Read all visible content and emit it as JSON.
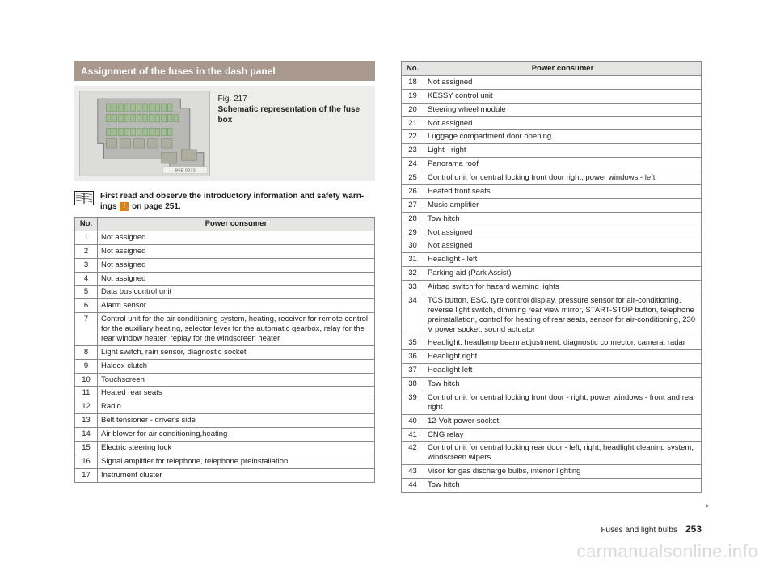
{
  "section_title": "Assignment of the fuses in the dash panel",
  "figure": {
    "num": "Fig. 217",
    "title": "Schematic representation of the fuse box",
    "code": "B5E-0233"
  },
  "note": {
    "text_a": "First read and observe the introductory information and safety warn-",
    "text_b": "ings ",
    "text_c": " on page 251.",
    "warn_glyph": "!"
  },
  "headers": {
    "no": "No.",
    "pc": "Power consumer"
  },
  "fuses_left": [
    {
      "no": "1",
      "pc": "Not assigned"
    },
    {
      "no": "2",
      "pc": "Not assigned"
    },
    {
      "no": "3",
      "pc": "Not assigned"
    },
    {
      "no": "4",
      "pc": "Not assigned"
    },
    {
      "no": "5",
      "pc": "Data bus control unit"
    },
    {
      "no": "6",
      "pc": "Alarm sensor"
    },
    {
      "no": "7",
      "pc": "Control unit for the air conditioning system, heating, receiver for remote control for the auxiliary heating, selector lever for the automatic gearbox, relay for the rear window heater, replay for the windscreen heater"
    },
    {
      "no": "8",
      "pc": "Light switch, rain sensor, diagnostic socket"
    },
    {
      "no": "9",
      "pc": "Haldex clutch"
    },
    {
      "no": "10",
      "pc": "Touchscreen"
    },
    {
      "no": "11",
      "pc": "Heated rear seats"
    },
    {
      "no": "12",
      "pc": "Radio"
    },
    {
      "no": "13",
      "pc": "Belt tensioner - driver's side"
    },
    {
      "no": "14",
      "pc": "Air blower for air conditioning,heating"
    },
    {
      "no": "15",
      "pc": "Electric steering lock"
    },
    {
      "no": "16",
      "pc": "Signal amplifier for telephone, telephone preinstallation"
    },
    {
      "no": "17",
      "pc": "Instrument cluster"
    }
  ],
  "fuses_right": [
    {
      "no": "18",
      "pc": "Not assigned"
    },
    {
      "no": "19",
      "pc": "KESSY control unit"
    },
    {
      "no": "20",
      "pc": "Steering wheel module"
    },
    {
      "no": "21",
      "pc": "Not assigned"
    },
    {
      "no": "22",
      "pc": "Luggage compartment door opening"
    },
    {
      "no": "23",
      "pc": "Light - right"
    },
    {
      "no": "24",
      "pc": "Panorama roof"
    },
    {
      "no": "25",
      "pc": "Control unit for central locking front door right, power windows - left"
    },
    {
      "no": "26",
      "pc": "Heated front seats"
    },
    {
      "no": "27",
      "pc": "Music amplifier"
    },
    {
      "no": "28",
      "pc": "Tow hitch"
    },
    {
      "no": "29",
      "pc": "Not assigned"
    },
    {
      "no": "30",
      "pc": "Not assigned"
    },
    {
      "no": "31",
      "pc": "Headlight - left"
    },
    {
      "no": "32",
      "pc": "Parking aid (Park Assist)"
    },
    {
      "no": "33",
      "pc": "Airbag switch for hazard warning lights"
    },
    {
      "no": "34",
      "pc": "TCS button, ESC, tyre control display, pressure sensor for air-conditioning, reverse light switch, dimming rear view mirror, START-STOP button, telephone preinstallation, control for heating of rear seats, sensor for air-conditioning, 230 V power socket, sound actuator"
    },
    {
      "no": "35",
      "pc": "Headlight, headlamp beam adjustment, diagnostic connector, camera, radar"
    },
    {
      "no": "36",
      "pc": "Headlight right"
    },
    {
      "no": "37",
      "pc": "Headlight left"
    },
    {
      "no": "38",
      "pc": "Tow hitch"
    },
    {
      "no": "39",
      "pc": "Control unit for central locking front door - right, power windows - front and rear right"
    },
    {
      "no": "40",
      "pc": "12-Volt power socket"
    },
    {
      "no": "41",
      "pc": "CNG relay"
    },
    {
      "no": "42",
      "pc": "Control unit for central locking rear door - left, right, headlight cleaning system, windscreen wipers"
    },
    {
      "no": "43",
      "pc": "Visor for gas discharge bulbs, interior lighting"
    },
    {
      "no": "44",
      "pc": "Tow hitch"
    }
  ],
  "footer": {
    "section": "Fuses and light bulbs",
    "page": "253"
  },
  "watermark": "carmanualsonline.info",
  "more_arrow": "▸"
}
